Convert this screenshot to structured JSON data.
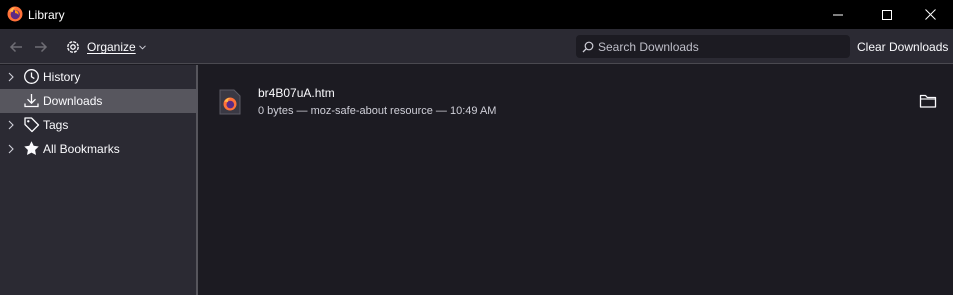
{
  "window": {
    "title": "Library",
    "app_icon": "firefox-icon",
    "controls": [
      "minimize-icon",
      "maximize-icon",
      "close-icon"
    ]
  },
  "toolbar": {
    "back_icon": "back-arrow-icon",
    "forward_icon": "forward-arrow-icon",
    "organize_label": "Organize",
    "organize_icon": "gear-icon",
    "search_placeholder": "Search Downloads",
    "search_value": "",
    "clear_label": "Clear Downloads"
  },
  "sidebar": {
    "items": [
      {
        "label": "History",
        "icon": "clock-icon",
        "expandable": true,
        "selected": false
      },
      {
        "label": "Downloads",
        "icon": "download-icon",
        "expandable": false,
        "selected": true
      },
      {
        "label": "Tags",
        "icon": "tag-icon",
        "expandable": true,
        "selected": false
      },
      {
        "label": "All Bookmarks",
        "icon": "star-icon",
        "expandable": true,
        "selected": false
      }
    ]
  },
  "downloads": [
    {
      "name": "br4B07uA.htm",
      "meta": "0 bytes — moz-safe-about resource — 10:49 AM",
      "icon": "firefox-file-icon",
      "action_icon": "folder-icon"
    }
  ],
  "colors": {
    "titlebar": "#000000",
    "toolbar": "#2b2a33",
    "sidebar": "#2b2a33",
    "sidebar_selected": "#57565e",
    "content": "#1c1b22",
    "text": "#fbfbfe"
  }
}
